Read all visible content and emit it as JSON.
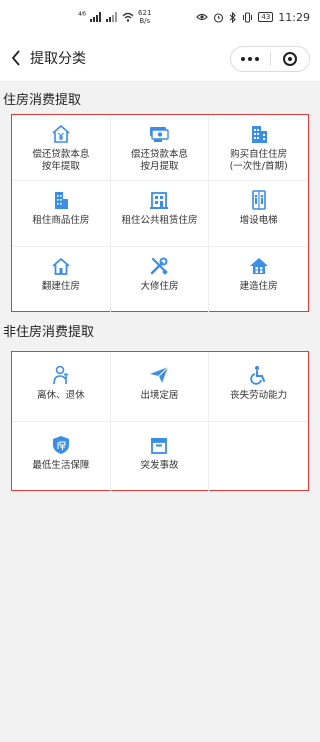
{
  "status_bar": {
    "network": "⁴⁶",
    "speed_value": "621",
    "speed_unit": "B/s",
    "battery": "43",
    "time": "11:29"
  },
  "nav": {
    "title": "提取分类"
  },
  "housing": {
    "title": "住房消费提取",
    "items": [
      {
        "label": "偿还贷款本息\n按年提取",
        "icon": "house-yen-icon"
      },
      {
        "label": "偿还贷款本息\n按月提取",
        "icon": "cash-stack-icon"
      },
      {
        "label": "购买自住住房\n(一次性/首期)",
        "icon": "building-icon"
      },
      {
        "label": "租住商品住房",
        "icon": "building-icon"
      },
      {
        "label": "租住公共租赁住房",
        "icon": "apartment-icon"
      },
      {
        "label": "增设电梯",
        "icon": "elevator-icon"
      },
      {
        "label": "翻建住房",
        "icon": "house-outline-icon"
      },
      {
        "label": "大修住房",
        "icon": "tools-icon"
      },
      {
        "label": "建造住房",
        "icon": "house-solid-icon"
      }
    ]
  },
  "non_housing": {
    "title": "非住房消费提取",
    "items": [
      {
        "label": "离休、退休",
        "icon": "retiree-icon"
      },
      {
        "label": "出境定居",
        "icon": "paper-plane-icon"
      },
      {
        "label": "丧失劳动能力",
        "icon": "wheelchair-icon"
      },
      {
        "label": "最低生活保障",
        "icon": "shield-bao-icon"
      },
      {
        "label": "突发事故",
        "icon": "box-icon"
      }
    ]
  },
  "colors": {
    "icon_blue": "#3a8ee6",
    "highlight_border": "#e03a3a"
  }
}
